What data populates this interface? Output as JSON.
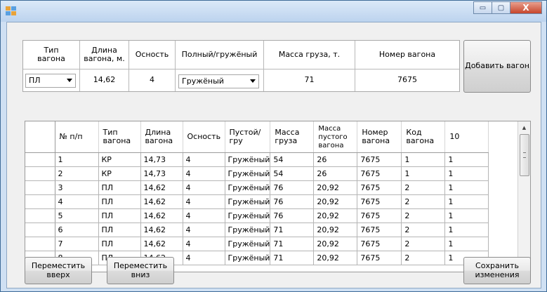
{
  "window": {
    "title": "",
    "controls": {
      "minimize": "▭",
      "maximize": "▢",
      "close": "X"
    }
  },
  "header": {
    "col_type": "Тип\nвагона",
    "col_length": "Длина\nвагона, м.",
    "col_axles": "Осность",
    "col_load": "Полный/гружёный",
    "col_mass": "Масса груза, т.",
    "col_number": "Номер вагона",
    "val_type": "ПЛ",
    "val_length": "14,62",
    "val_axles": "4",
    "val_load": "Гружёный",
    "val_mass": "71",
    "val_number": "7675"
  },
  "buttons": {
    "add_wagon": "Добавить вагон",
    "move_up": "Переместить\nвверх",
    "move_down": "Переместить\nвниз",
    "save": "Сохранить\nизменения"
  },
  "grid": {
    "columns": [
      "№ п/п",
      "Тип\nвагона",
      "Длина\nвагона",
      "Осность",
      "Пустой/гру",
      "Масса\nгруза",
      "Масса\nпустого\nвагона",
      "Номер\nвагона",
      "Код\nвагона",
      "10"
    ],
    "rows": [
      [
        "1",
        "КР",
        "14,73",
        "4",
        "Гружёный",
        "54",
        "26",
        "7675",
        "1",
        "1"
      ],
      [
        "2",
        "КР",
        "14,73",
        "4",
        "Гружёный",
        "54",
        "26",
        "7675",
        "1",
        "1"
      ],
      [
        "3",
        "ПЛ",
        "14,62",
        "4",
        "Гружёный",
        "76",
        "20,92",
        "7675",
        "2",
        "1"
      ],
      [
        "4",
        "ПЛ",
        "14,62",
        "4",
        "Гружёный",
        "76",
        "20,92",
        "7675",
        "2",
        "1"
      ],
      [
        "5",
        "ПЛ",
        "14,62",
        "4",
        "Гружёный",
        "76",
        "20,92",
        "7675",
        "2",
        "1"
      ],
      [
        "6",
        "ПЛ",
        "14,62",
        "4",
        "Гружёный",
        "71",
        "20,92",
        "7675",
        "2",
        "1"
      ],
      [
        "7",
        "ПЛ",
        "14,62",
        "4",
        "Гружёный",
        "71",
        "20,92",
        "7675",
        "2",
        "1"
      ],
      [
        "8",
        "ПЛ",
        "14,62",
        "4",
        "Гружёный",
        "71",
        "20,92",
        "7675",
        "2",
        "1"
      ]
    ]
  }
}
